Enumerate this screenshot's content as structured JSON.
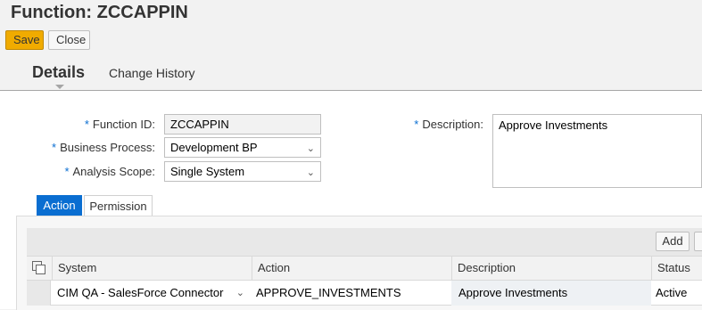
{
  "header": {
    "title": "Function: ZCCAPPIN",
    "save_label": "Save",
    "close_label": "Close"
  },
  "tabs": {
    "details": "Details",
    "change_history": "Change History"
  },
  "form": {
    "function_id": {
      "label": "Function ID:",
      "value": "ZCCAPPIN"
    },
    "business_process": {
      "label": "Business Process:",
      "value": "Development BP"
    },
    "analysis_scope": {
      "label": "Analysis Scope:",
      "value": "Single System"
    },
    "description": {
      "label": "Description:",
      "value": "Approve Investments"
    },
    "required_marker": "*"
  },
  "subtabs": {
    "action": "Action",
    "permission": "Permission"
  },
  "table": {
    "add_label": "Add",
    "columns": [
      "System",
      "Action",
      "Description",
      "Status"
    ],
    "rows": [
      {
        "system": "CIM QA - SalesForce Connector",
        "action": "APPROVE_INVESTMENTS",
        "description": "Approve Investments",
        "status": "Active"
      }
    ]
  },
  "colors": {
    "accent": "#0a6ed1",
    "save_button": "#f0ab00"
  }
}
